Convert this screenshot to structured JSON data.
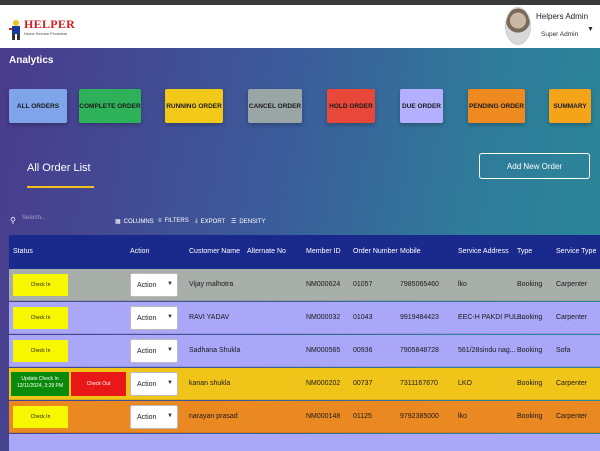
{
  "header": {
    "logo_text": "HELPER",
    "logo_sub": "Home Service Providers",
    "user_name": "Helpers Admin",
    "user_role": "Super Admin"
  },
  "page": {
    "analytics_label": "Analytics",
    "list_title": "All Order List",
    "add_button": "Add New Order"
  },
  "tiles": [
    {
      "label": "All Orders",
      "color": "#7fa4ea"
    },
    {
      "label": "Complete Order",
      "color": "#2db25a"
    },
    {
      "label": "Running Order",
      "color": "#f2c918"
    },
    {
      "label": "Cancel Order",
      "color": "#9aa6a6"
    },
    {
      "label": "Hold Order",
      "color": "#e8483a"
    },
    {
      "label": "Due Order",
      "color": "#b4b0ff"
    },
    {
      "label": "Pending Order",
      "color": "#ee8a20"
    },
    {
      "label": "Summary",
      "color": "#f5a41a"
    }
  ],
  "toolbar": {
    "search_placeholder": "Search...",
    "columns": "COLUMNS",
    "filters": "FILTERS",
    "export": "EXPORT",
    "density": "DENSITY"
  },
  "table": {
    "headers": [
      "Status",
      "Action",
      "Customer Name",
      "Alternate No",
      "Member ID",
      "Order Number",
      "Mobile",
      "Service Address",
      "Type",
      "Service Type"
    ],
    "action_label": "Action",
    "rows": [
      {
        "color": "#a8aeaa",
        "status": "Check In",
        "name": "Vijay malhotra",
        "member": "NM000624",
        "order": "01057",
        "mobile": "7985065460",
        "address": "lko",
        "type": "Booking",
        "service": "Carpenter"
      },
      {
        "color": "#aaa6f8",
        "status": "Check In",
        "name": "RAVI YADAV",
        "member": "NM000032",
        "order": "01043",
        "mobile": "9919484423",
        "address": "EEC-H PAKDI PUL ...",
        "type": "Booking",
        "service": "Carpenter"
      },
      {
        "color": "#aaa6f8",
        "status": "Check In",
        "name": "Sadhana Shukla",
        "member": "NM000565",
        "order": "00936",
        "mobile": "7905848728",
        "address": "561/28sindu nag...",
        "type": "Booking",
        "service": "Sofa"
      },
      {
        "color": "#f0c418",
        "status": "Update Check In",
        "status_time": "13/11/2024, 3:29 PM",
        "checkout": "Check Out",
        "name": "kanan shukla",
        "member": "NM000202",
        "order": "00737",
        "mobile": "7311167670",
        "address": "LKO",
        "type": "Booking",
        "service": "Carpenter"
      },
      {
        "color": "#ea8822",
        "status": "Check In",
        "name": "narayan prasad",
        "member": "NM000148",
        "order": "01125",
        "mobile": "9792385000",
        "address": "lko",
        "type": "Booking",
        "service": "Carpenter"
      }
    ]
  }
}
